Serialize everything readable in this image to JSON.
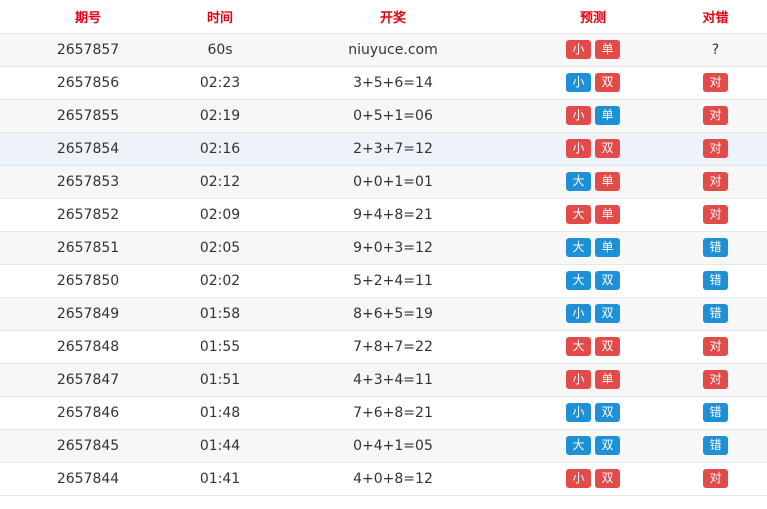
{
  "headers": [
    "期号",
    "时间",
    "开奖",
    "预测",
    "对错"
  ],
  "colors": {
    "red": "#e34b4b",
    "blue": "#1e90d8",
    "header": "#e60012"
  },
  "rows": [
    {
      "id": "2657857",
      "time": "60s",
      "result": "niuyuce.com",
      "p1": "小",
      "p1c": "red",
      "p2": "单",
      "p2c": "red",
      "v": "?",
      "vc": "none"
    },
    {
      "id": "2657856",
      "time": "02:23",
      "result": "3+5+6=14",
      "p1": "小",
      "p1c": "blue",
      "p2": "双",
      "p2c": "red",
      "v": "对",
      "vc": "red"
    },
    {
      "id": "2657855",
      "time": "02:19",
      "result": "0+5+1=06",
      "p1": "小",
      "p1c": "red",
      "p2": "单",
      "p2c": "blue",
      "v": "对",
      "vc": "red"
    },
    {
      "id": "2657854",
      "time": "02:16",
      "result": "2+3+7=12",
      "p1": "小",
      "p1c": "red",
      "p2": "双",
      "p2c": "red",
      "v": "对",
      "vc": "red"
    },
    {
      "id": "2657853",
      "time": "02:12",
      "result": "0+0+1=01",
      "p1": "大",
      "p1c": "blue",
      "p2": "单",
      "p2c": "red",
      "v": "对",
      "vc": "red"
    },
    {
      "id": "2657852",
      "time": "02:09",
      "result": "9+4+8=21",
      "p1": "大",
      "p1c": "red",
      "p2": "单",
      "p2c": "red",
      "v": "对",
      "vc": "red"
    },
    {
      "id": "2657851",
      "time": "02:05",
      "result": "9+0+3=12",
      "p1": "大",
      "p1c": "blue",
      "p2": "单",
      "p2c": "blue",
      "v": "错",
      "vc": "blue"
    },
    {
      "id": "2657850",
      "time": "02:02",
      "result": "5+2+4=11",
      "p1": "大",
      "p1c": "blue",
      "p2": "双",
      "p2c": "blue",
      "v": "错",
      "vc": "blue"
    },
    {
      "id": "2657849",
      "time": "01:58",
      "result": "8+6+5=19",
      "p1": "小",
      "p1c": "blue",
      "p2": "双",
      "p2c": "blue",
      "v": "错",
      "vc": "blue"
    },
    {
      "id": "2657848",
      "time": "01:55",
      "result": "7+8+7=22",
      "p1": "大",
      "p1c": "red",
      "p2": "双",
      "p2c": "red",
      "v": "对",
      "vc": "red"
    },
    {
      "id": "2657847",
      "time": "01:51",
      "result": "4+3+4=11",
      "p1": "小",
      "p1c": "red",
      "p2": "单",
      "p2c": "red",
      "v": "对",
      "vc": "red"
    },
    {
      "id": "2657846",
      "time": "01:48",
      "result": "7+6+8=21",
      "p1": "小",
      "p1c": "blue",
      "p2": "双",
      "p2c": "blue",
      "v": "错",
      "vc": "blue"
    },
    {
      "id": "2657845",
      "time": "01:44",
      "result": "0+4+1=05",
      "p1": "大",
      "p1c": "blue",
      "p2": "双",
      "p2c": "blue",
      "v": "错",
      "vc": "blue"
    },
    {
      "id": "2657844",
      "time": "01:41",
      "result": "4+0+8=12",
      "p1": "小",
      "p1c": "red",
      "p2": "双",
      "p2c": "red",
      "v": "对",
      "vc": "red"
    }
  ]
}
